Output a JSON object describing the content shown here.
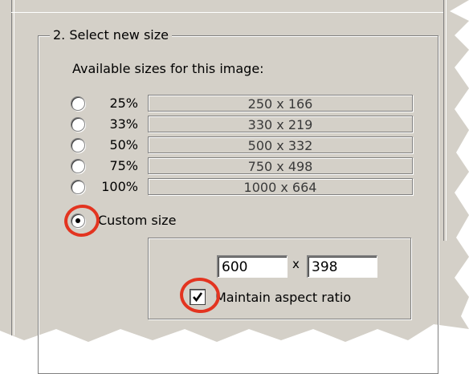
{
  "group": {
    "legend": "2. Select new size"
  },
  "available_label": "Available sizes for this image:",
  "sizes": [
    {
      "percent": "25%",
      "dims": "250 x 166",
      "selected": false
    },
    {
      "percent": "33%",
      "dims": "330 x 219",
      "selected": false
    },
    {
      "percent": "50%",
      "dims": "500 x 332",
      "selected": false
    },
    {
      "percent": "75%",
      "dims": "750 x 498",
      "selected": false
    },
    {
      "percent": "100%",
      "dims": "1000 x 664",
      "selected": false
    }
  ],
  "custom": {
    "label": "Custom size",
    "selected": true,
    "width_value": "600",
    "height_value": "398",
    "times": "x",
    "maintain_label": "Maintain aspect ratio",
    "maintain_checked": true
  },
  "colors": {
    "panel": "#d4d0c8",
    "annotation": "#e33420"
  }
}
